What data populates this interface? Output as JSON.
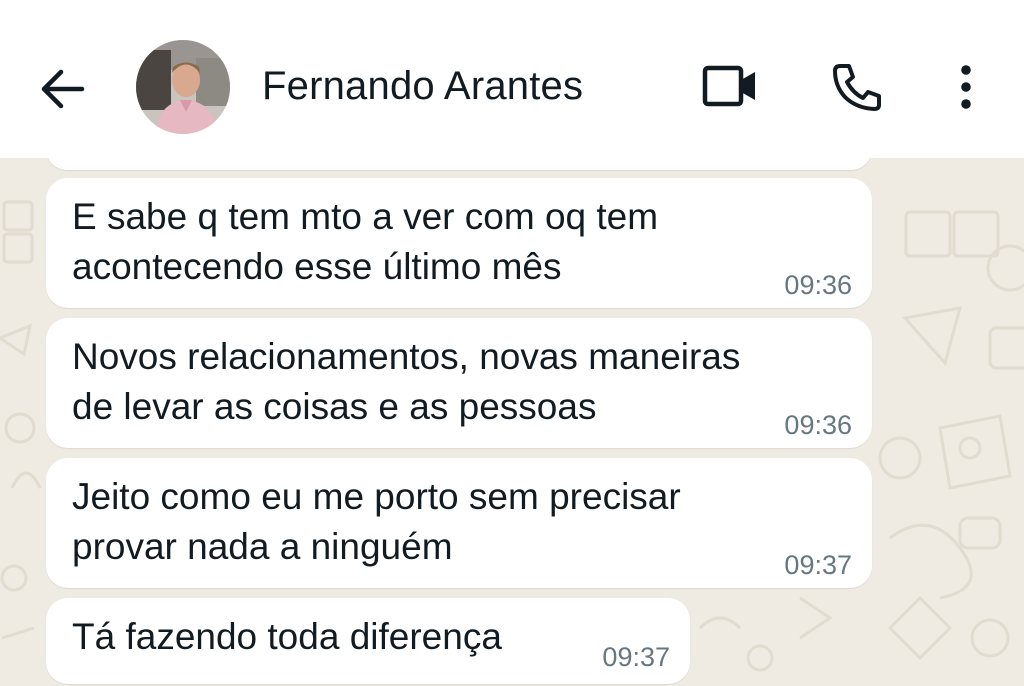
{
  "header": {
    "contact_name": "Fernando Arantes",
    "icons": [
      "back-arrow-icon",
      "avatar",
      "video-call-icon",
      "voice-call-icon",
      "more-options-icon"
    ]
  },
  "messages": [
    {
      "line1": "E sabe q tem mto a ver com oq tem",
      "line2": "acontecendo esse último mês",
      "time": "09:36"
    },
    {
      "line1": "Novos relacionamentos, novas maneiras",
      "line2": "de levar as coisas e as pessoas",
      "time": "09:36"
    },
    {
      "line1": "Jeito como eu me porto sem precisar",
      "line2": "provar nada a ninguém",
      "time": "09:37"
    },
    {
      "line1": "Tá fazendo toda diferença",
      "time": "09:37"
    }
  ],
  "colors": {
    "header_bg": "#ffffff",
    "chat_bg": "#efeae2",
    "bubble_bg": "#ffffff",
    "text": "#111b21",
    "timestamp": "#667781"
  }
}
